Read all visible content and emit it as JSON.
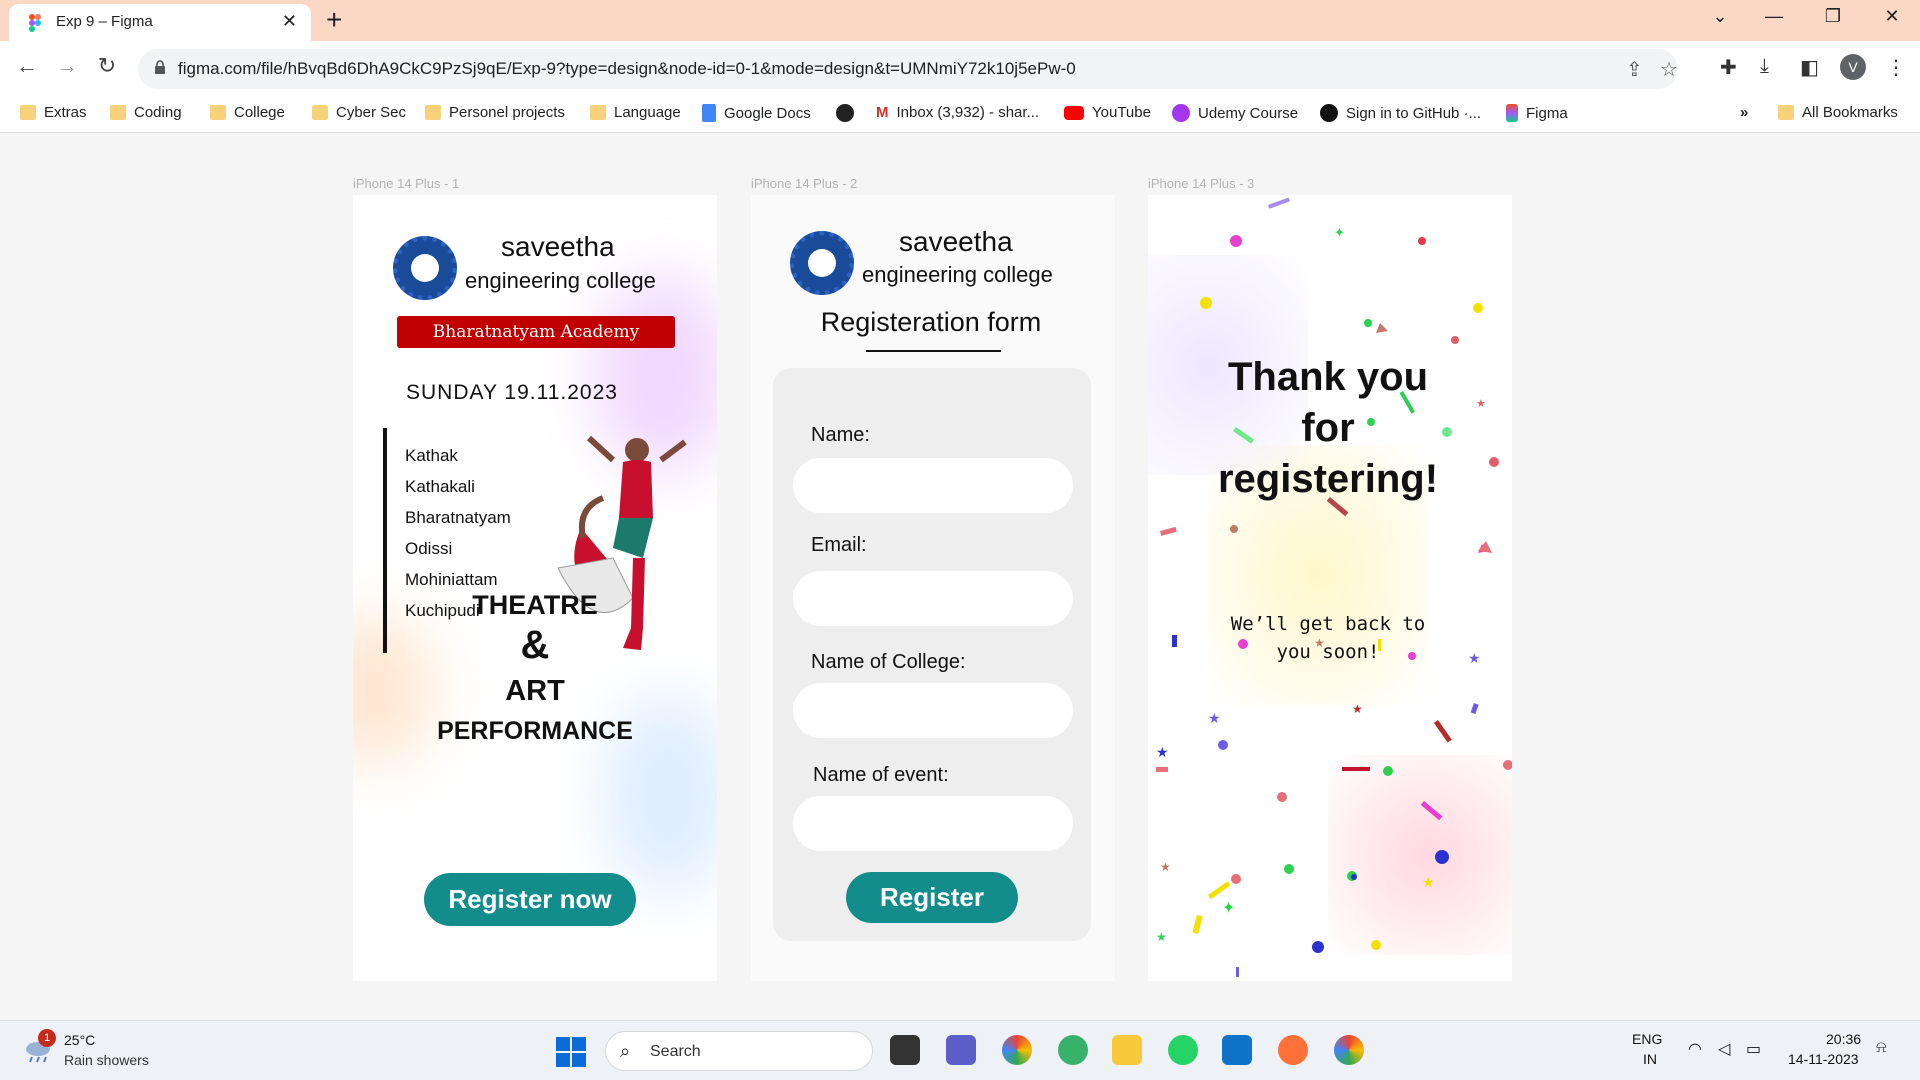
{
  "browser": {
    "tab_title": "Exp 9 – Figma",
    "url": "figma.com/file/hBvqBd6DhA9CkC9PzSj9qE/Exp-9?type=design&node-id=0-1&mode=design&t=UMNmiY72k10j5ePw-0",
    "avatar_letter": "V"
  },
  "bookmarks": [
    {
      "label": "Extras",
      "icon": "folder-icon"
    },
    {
      "label": "Coding",
      "icon": "folder-icon"
    },
    {
      "label": "College",
      "icon": "folder-icon"
    },
    {
      "label": "Cyber Sec",
      "icon": "folder-icon"
    },
    {
      "label": "Personel projects",
      "icon": "folder-icon"
    },
    {
      "label": "Language",
      "icon": "folder-icon"
    },
    {
      "label": "Google Docs",
      "icon": "docs-icon"
    },
    {
      "label": "",
      "icon": "globe-icon"
    },
    {
      "label": "Inbox (3,932) - shar...",
      "icon": "gmail-icon"
    },
    {
      "label": "YouTube",
      "icon": "youtube-icon"
    },
    {
      "label": "Udemy Course",
      "icon": "udemy-icon"
    },
    {
      "label": "Sign in to GitHub ·...",
      "icon": "github-icon"
    },
    {
      "label": "Figma",
      "icon": "figma-icon"
    }
  ],
  "bookmarks_more": "»",
  "all_bookmarks": "All Bookmarks",
  "frames": {
    "f1": {
      "label": "iPhone 14 Plus - 1",
      "college_name": "saveetha",
      "college_sub": "engineering college",
      "academy": "Bharatnatyam Academy",
      "date": "SUNDAY  19.11.2023",
      "dances": [
        "Kathak",
        "Kathakali",
        "Bharatnatyam",
        "Odissi",
        "Mohiniattam",
        "Kuchipudi"
      ],
      "theatre": "THEATRE",
      "amp": "&",
      "art": "ART",
      "performance": "PERFORMANCE",
      "cta": "Register now"
    },
    "f2": {
      "label": "iPhone 14 Plus - 2",
      "college_name": "saveetha",
      "college_sub": "engineering college",
      "title": "Registeration form",
      "fields": [
        "Name:",
        "Email:",
        "Name of College:",
        "Name of event:"
      ],
      "button": "Register"
    },
    "f3": {
      "label": "iPhone 14 Plus - 3",
      "line1": "Thank you",
      "line2": "for",
      "line3": "registering!",
      "msg1": "We’ll get back to",
      "msg2": "you soon!"
    }
  },
  "taskbar": {
    "weather_badge": "1",
    "temperature": "25°C",
    "condition": "Rain showers",
    "search": "Search",
    "lang1": "ENG",
    "lang2": "IN",
    "time": "20:36",
    "date": "14-11-2023"
  },
  "colors": {
    "accent_teal": "#138c8c",
    "academy_red": "#c00000",
    "tab_strip": "#fbd8c6"
  }
}
